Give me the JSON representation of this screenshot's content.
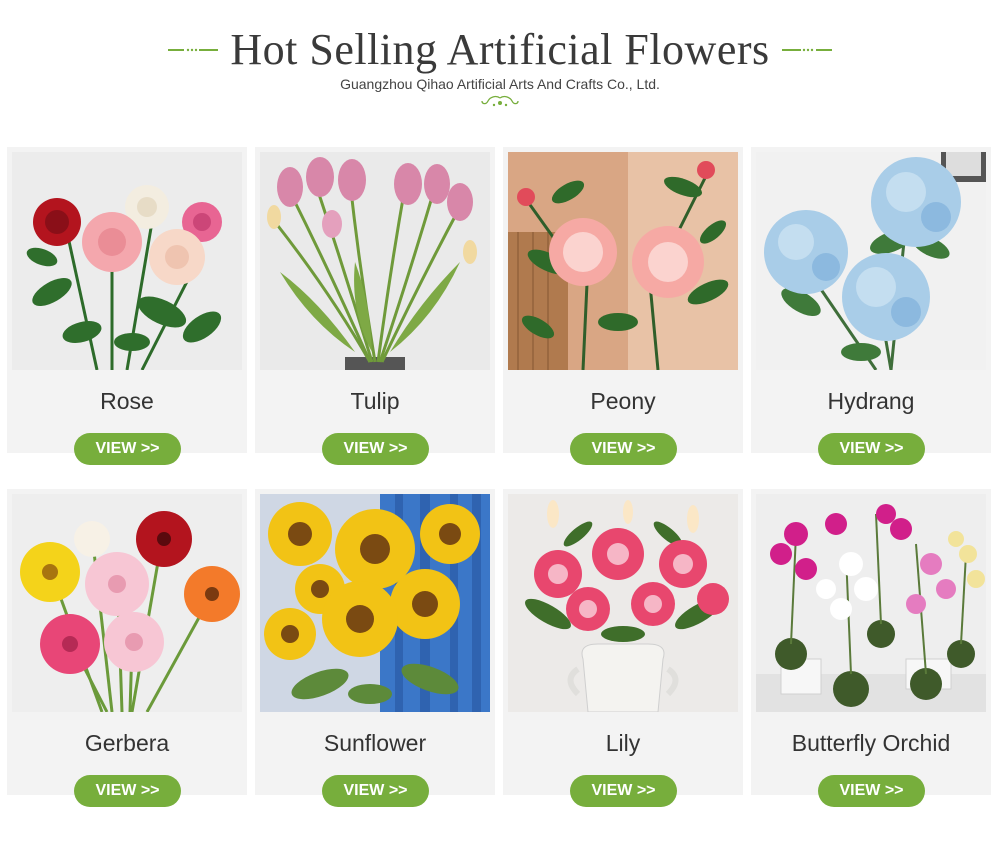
{
  "header": {
    "title": "Hot Selling Artificial Flowers",
    "subtitle": "Guangzhou Qihao Artificial Arts And Crafts Co., Ltd."
  },
  "colors": {
    "accent_green": "#77ae3c",
    "card_bg": "#f3f3f3",
    "title_text": "#3a3a3a"
  },
  "products": [
    {
      "name": "Rose",
      "button": "VIEW >>",
      "flower_colors": [
        "#b3141e",
        "#f4a7ad",
        "#f3ede0",
        "#e86593",
        "#f7d8c8"
      ]
    },
    {
      "name": "Tulip",
      "button": "VIEW >>",
      "flower_colors": [
        "#d887a9",
        "#e4a0bd",
        "#f1d9a0"
      ]
    },
    {
      "name": "Peony",
      "button": "VIEW >>",
      "flower_colors": [
        "#f6a9a4",
        "#fbd3cf",
        "#e14b5a"
      ]
    },
    {
      "name": "Hydrang",
      "button": "VIEW >>",
      "flower_colors": [
        "#a9cde8",
        "#c4def0",
        "#8cb9df"
      ]
    },
    {
      "name": "Gerbera",
      "button": "VIEW >>",
      "flower_colors": [
        "#f4d31a",
        "#b3141e",
        "#f37a2a",
        "#e84677",
        "#f7c6d4"
      ]
    },
    {
      "name": "Sunflower",
      "button": "VIEW >>",
      "flower_colors": [
        "#f2c315",
        "#7a4a12",
        "#3b77c8"
      ]
    },
    {
      "name": "Lily",
      "button": "VIEW >>",
      "flower_colors": [
        "#e8476e",
        "#f6b6c6",
        "#fbe7c6"
      ]
    },
    {
      "name": "Butterfly Orchid",
      "button": "VIEW >>",
      "flower_colors": [
        "#d11f8a",
        "#ffffff",
        "#f2e39a",
        "#e57cc0"
      ]
    }
  ]
}
